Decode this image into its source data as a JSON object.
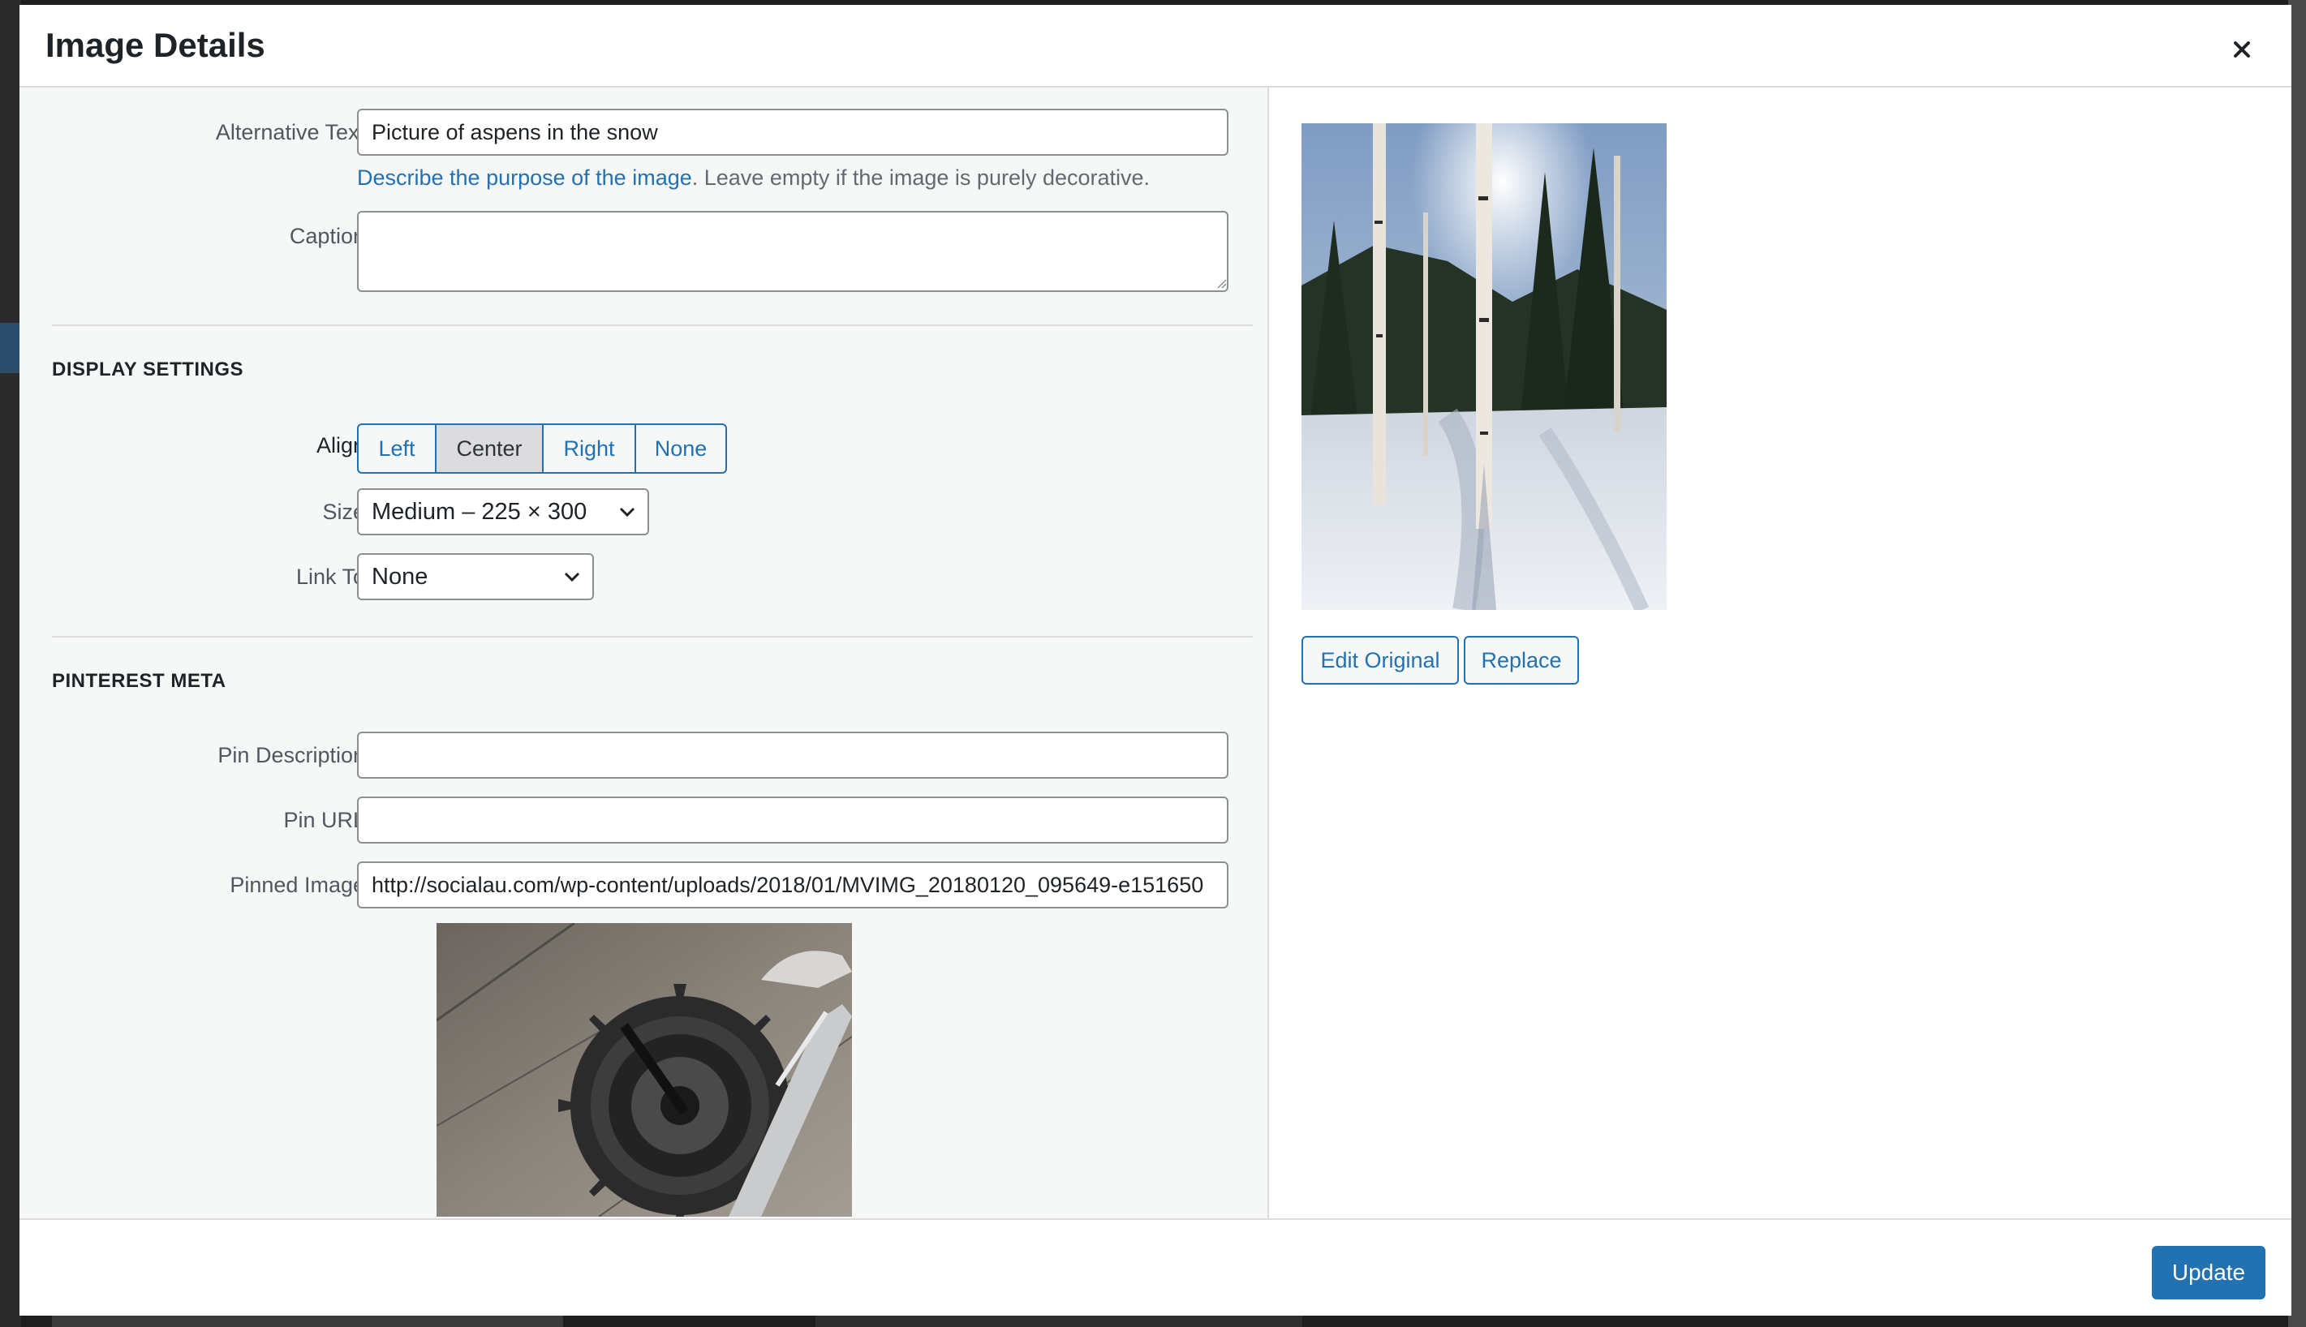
{
  "modal": {
    "title": "Image Details",
    "close_label": "×"
  },
  "attachment": {
    "alt_text": {
      "label": "Alternative Text",
      "value": "Picture of aspens in the snow"
    },
    "alt_help": {
      "link_text": "Describe the purpose of the image",
      "rest": ". Leave empty if the image is purely decorative."
    },
    "caption": {
      "label": "Caption",
      "value": ""
    }
  },
  "display_settings": {
    "heading": "DISPLAY SETTINGS",
    "align": {
      "label": "Align",
      "options": [
        "Left",
        "Center",
        "Right",
        "None"
      ],
      "selected": "Center"
    },
    "size": {
      "label": "Size",
      "value": "Medium – 225 × 300"
    },
    "link_to": {
      "label": "Link To",
      "value": "None"
    }
  },
  "pinterest": {
    "heading": "PINTEREST META",
    "pin_description": {
      "label": "Pin Description",
      "value": ""
    },
    "pin_url": {
      "label": "Pin URL",
      "value": ""
    },
    "pinned_image": {
      "label": "Pinned Image",
      "value": "http://socialau.com/wp-content/uploads/2018/01/MVIMG_20180120_095649-e151650"
    }
  },
  "preview": {
    "edit_original_label": "Edit Original",
    "replace_label": "Replace"
  },
  "footer": {
    "update_label": "Update"
  },
  "colors": {
    "accent": "#2271b1",
    "panel": "#f6f7f7",
    "border": "#dcdcde"
  }
}
